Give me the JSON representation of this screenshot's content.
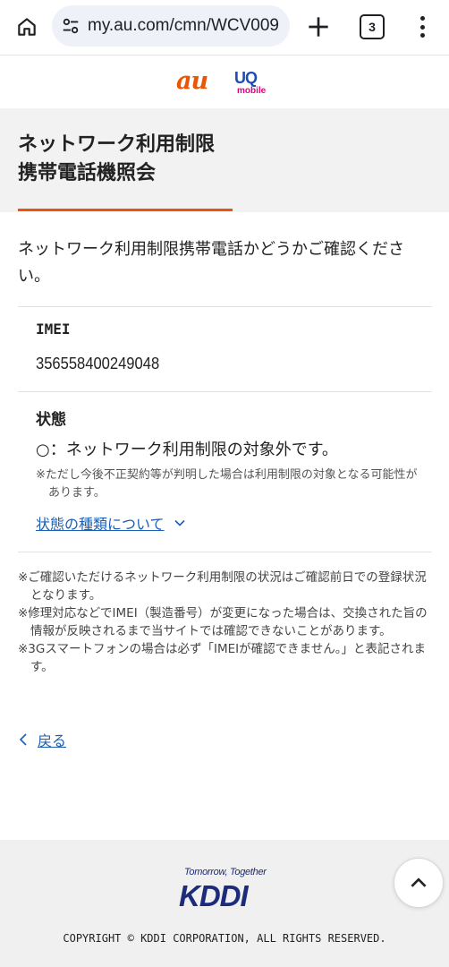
{
  "browser": {
    "url": "my.au.com/cmn/WCV009",
    "tab_count": "3"
  },
  "header": {
    "au_logo": "au",
    "uq_logo_main": "UQ",
    "uq_logo_sub": "mobile"
  },
  "page": {
    "title_line1": "ネットワーク利用制限",
    "title_line2": "携帯電話機照会",
    "intro": "ネットワーク利用制限携帯電話かどうかご確認ください。"
  },
  "imei": {
    "label": "IMEI",
    "value": "356558400249048"
  },
  "status": {
    "label": "状態",
    "text": "○：ネットワーク利用制限の対象外です。",
    "note": "※ただし今後不正契約等が判明した場合は利用制限の対象となる可能性があります。",
    "link_label": "状態の種類について"
  },
  "notes": [
    "※ご確認いただけるネットワーク利用制限の状況はご確認前日での登録状況となります。",
    "※修理対応などでIMEI（製造番号）が変更になった場合は、交換された旨の情報が反映されるまで当サイトでは確認できないことがあります。",
    "※3Gスマートフォンの場合は必ず「IMEIが確認できません。」と表記されます。"
  ],
  "back_label": "戻る",
  "footer": {
    "tagline": "Tomorrow, Together",
    "logo": "KDDI",
    "copyright": "COPYRIGHT © KDDI CORPORATION, ALL RIGHTS RESERVED."
  },
  "colors": {
    "accent_orange": "#eb5505",
    "link_blue": "#1a5fb4",
    "kddi_navy": "#1c2b7a",
    "uq_blue": "#1c4db1",
    "uq_pink": "#e4007f"
  },
  "icons": {
    "home": "home-icon",
    "site_settings": "tune-icon",
    "new_tab": "plus-icon",
    "tabs": "tab-switcher-icon",
    "menu": "more-vert-icon",
    "status_link": "chevron-down-icon",
    "back": "chevron-left-icon",
    "scroll_top": "chevron-up-icon"
  }
}
